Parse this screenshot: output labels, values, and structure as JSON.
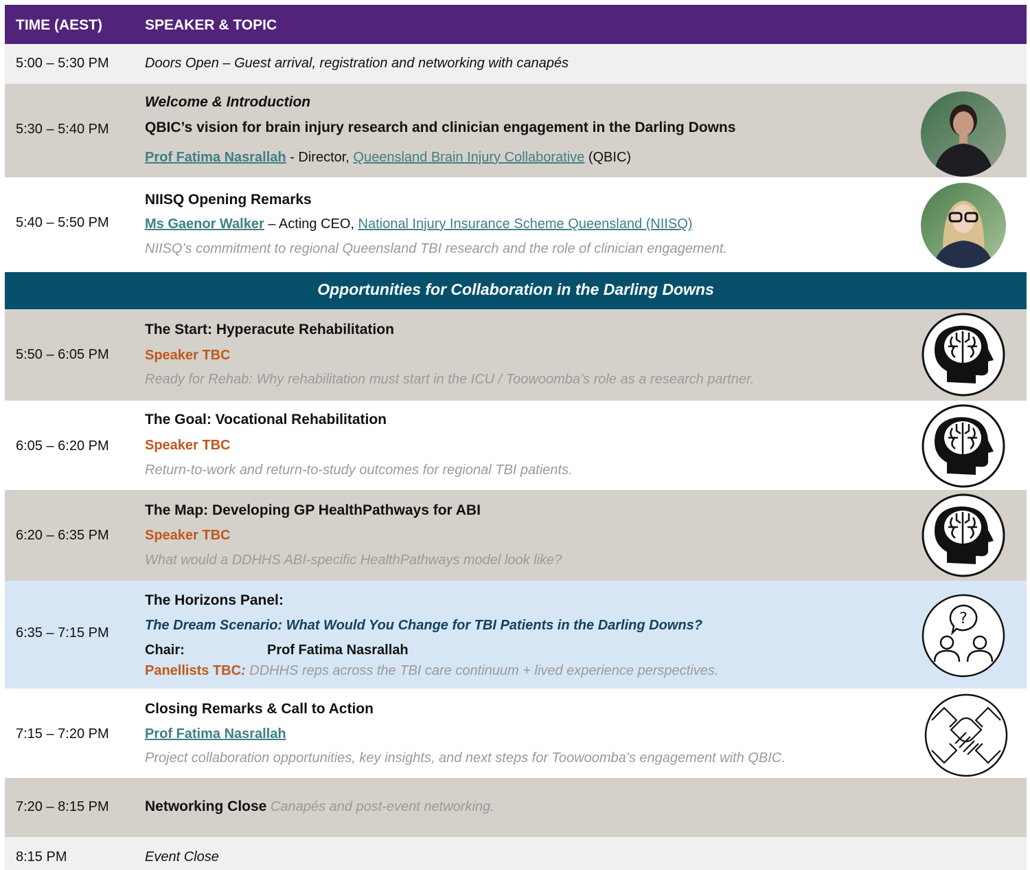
{
  "header": {
    "time_col": "TIME (AEST)",
    "topic_col": "SPEAKER & TOPIC"
  },
  "rows": {
    "doors": {
      "time": "5:00 – 5:30 PM",
      "text": "Doors Open – Guest arrival, registration and networking with canapés"
    },
    "welcome": {
      "time": "5:30 – 5:40 PM",
      "title": "Welcome & Introduction",
      "subtitle": "QBIC’s vision for brain injury research and clinician engagement in the Darling Downs",
      "speaker": "Prof Fatima Nasrallah",
      "speaker_role_pre": " - Director, ",
      "org": "Queensland Brain Injury Collaborative",
      "org_suffix": " (QBIC)"
    },
    "niisq": {
      "time": "5:40 – 5:50 PM",
      "title": "NIISQ Opening Remarks",
      "speaker": "Ms Gaenor Walker",
      "speaker_role_pre": " – Acting CEO, ",
      "org": "National Injury Insurance Scheme Queensland (NIISQ)",
      "desc": "NIISQ’s commitment to regional Queensland TBI research and the role of clinician engagement."
    },
    "section": {
      "title": "Opportunities for Collaboration in the Darling Downs"
    },
    "start": {
      "time": "5:50 – 6:05 PM",
      "title": "The Start: Hyperacute Rehabilitation",
      "speaker": "Speaker TBC",
      "desc": "Ready for Rehab: Why rehabilitation must start in the ICU / Toowoomba’s role as a research partner."
    },
    "goal": {
      "time": "6:05 – 6:20 PM",
      "title": "The Goal: Vocational Rehabilitation",
      "speaker": "Speaker TBC",
      "desc": "Return-to-work and return-to-study outcomes for regional TBI patients."
    },
    "map": {
      "time": "6:20 – 6:35 PM",
      "title": "The Map: Developing GP HealthPathways for ABI",
      "speaker": "Speaker TBC",
      "desc": "What would a DDHHS ABI-specific HealthPathways model look like?"
    },
    "panel": {
      "time": "6:35 – 7:15 PM",
      "title": "The Horizons Panel:",
      "subtitle": "The Dream Scenario: What Would You Change for TBI Patients in the Darling Downs?",
      "chair_label": "Chair:",
      "chair_name": "Prof Fatima Nasrallah",
      "panellists_label": "Panellists TBC",
      "panellists_sep": ":",
      "panellists_desc": " DDHHS reps across the TBI care continuum + lived experience perspectives."
    },
    "closing": {
      "time": "7:15 – 7:20 PM",
      "title": "Closing Remarks & Call to Action",
      "speaker": "Prof Fatima Nasrallah",
      "desc": "Project collaboration opportunities, key insights, and next steps for Toowoomba’s engagement with QBIC."
    },
    "networking": {
      "time": "7:20 – 8:15 PM",
      "title": "Networking Close",
      "desc": " Canapés and post-event networking."
    },
    "close": {
      "time": "8:15 PM",
      "text": "Event Close"
    }
  },
  "colors": {
    "header": "#51237a",
    "section": "#06506b",
    "tan": "#d5d1ca",
    "panel_blue": "#d7e6f4",
    "link": "#3e7f86",
    "tbc_orange": "#c0581d"
  },
  "icons": {
    "welcome": "speaker-photo",
    "niisq": "speaker-photo",
    "start": "brain-head-icon",
    "goal": "brain-head-icon",
    "map": "brain-head-icon",
    "panel": "panel-question-icon",
    "closing": "collaboration-hands-icon"
  }
}
